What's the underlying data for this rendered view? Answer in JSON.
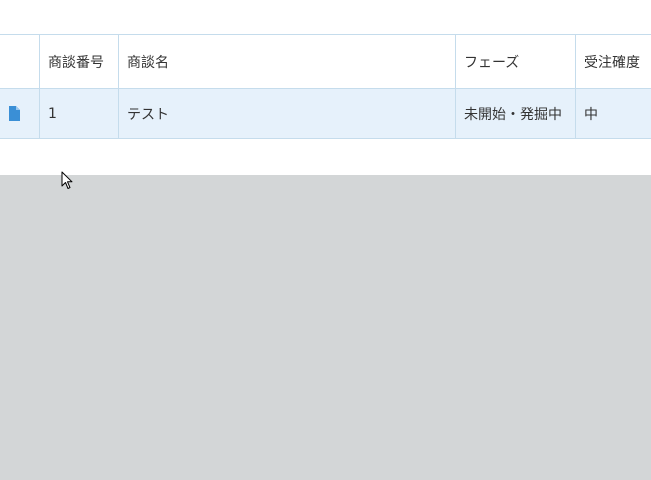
{
  "table": {
    "columns": [
      "",
      "商談番号",
      "商談名",
      "フェーズ",
      "受注確度"
    ],
    "rows": [
      {
        "icon": "document-icon",
        "number": "1",
        "name": "テスト",
        "phase": "未開始・発掘中",
        "confidence": "中"
      }
    ]
  },
  "colors": {
    "header_bg": "#ffffff",
    "row_bg": "#e6f1fb",
    "border": "#c5dcec",
    "icon": "#3a8fd6",
    "background": "#d3d6d7"
  }
}
